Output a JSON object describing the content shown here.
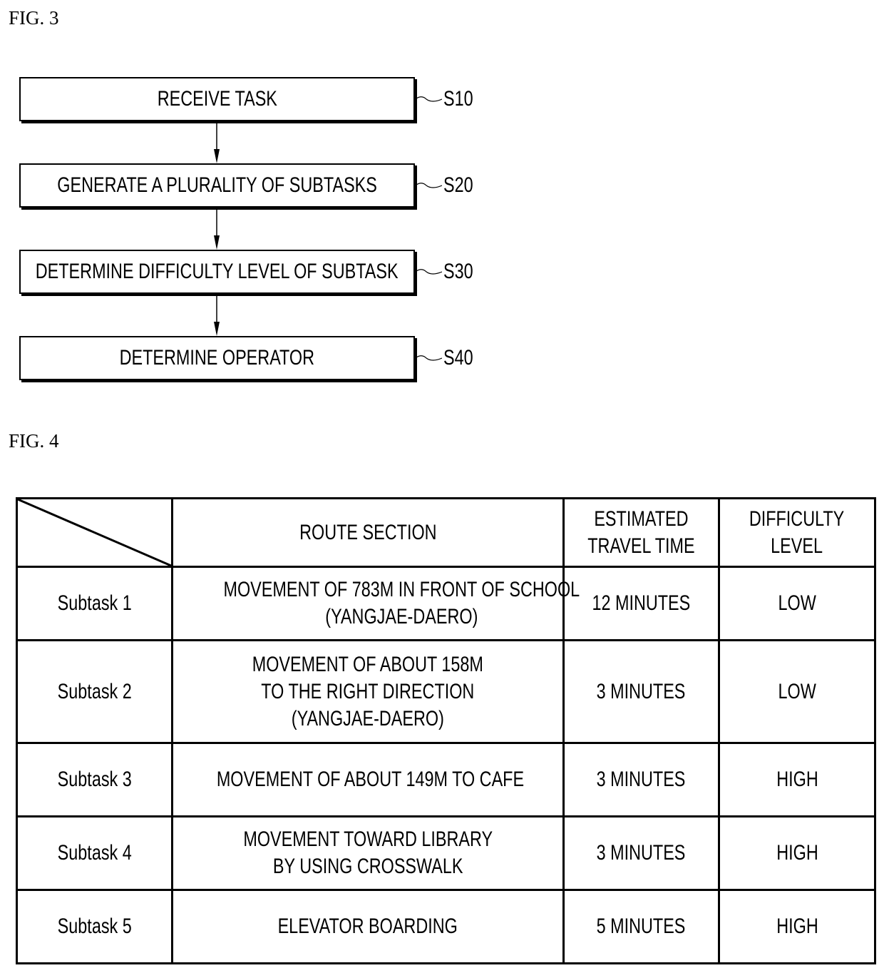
{
  "figures": {
    "fig3": {
      "label": "FIG. 3",
      "steps": [
        {
          "ref": "S10",
          "text": "RECEIVE TASK"
        },
        {
          "ref": "S20",
          "text": "GENERATE A PLURALITY OF SUBTASKS"
        },
        {
          "ref": "S30",
          "text": "DETERMINE DIFFICULTY LEVEL OF SUBTASK"
        },
        {
          "ref": "S40",
          "text": "DETERMINE OPERATOR"
        }
      ]
    },
    "fig4": {
      "label": "FIG. 4",
      "table": {
        "headers": {
          "corner": "",
          "route_section": "ROUTE SECTION",
          "travel_time": [
            "ESTIMATED",
            "TRAVEL TIME"
          ],
          "difficulty": [
            "DIFFICULTY",
            "LEVEL"
          ]
        },
        "rows": [
          {
            "subtask": "Subtask 1",
            "route_lines": [
              "MOVEMENT OF 783M IN FRONT OF SCHOOL",
              "(YANGJAE-DAERO)"
            ],
            "travel_time": "12 MINUTES",
            "difficulty": "LOW"
          },
          {
            "subtask": "Subtask 2",
            "route_lines": [
              "MOVEMENT OF ABOUT 158M",
              "TO THE RIGHT DIRECTION",
              "(YANGJAE-DAERO)"
            ],
            "travel_time": "3 MINUTES",
            "difficulty": "LOW"
          },
          {
            "subtask": "Subtask 3",
            "route_lines": [
              "MOVEMENT OF ABOUT 149M TO CAFE"
            ],
            "travel_time": "3 MINUTES",
            "difficulty": "HIGH"
          },
          {
            "subtask": "Subtask 4",
            "route_lines": [
              "MOVEMENT TOWARD LIBRARY",
              "BY USING CROSSWALK"
            ],
            "travel_time": "3 MINUTES",
            "difficulty": "HIGH"
          },
          {
            "subtask": "Subtask 5",
            "route_lines": [
              "ELEVATOR BOARDING"
            ],
            "travel_time": "5 MINUTES",
            "difficulty": "HIGH"
          }
        ]
      }
    }
  }
}
